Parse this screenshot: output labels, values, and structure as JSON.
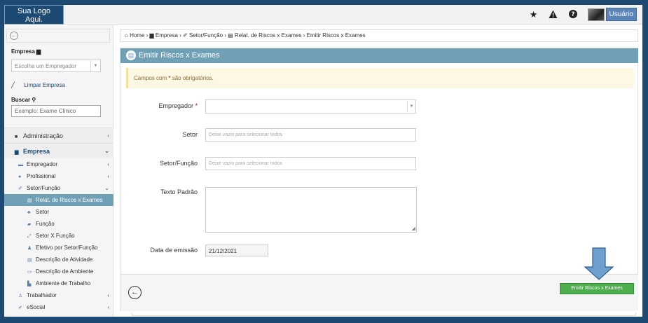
{
  "topbar": {
    "logo_line1": "Sua Logo",
    "logo_line2": "Aqui.",
    "icons": [
      "star-icon",
      "warning-icon",
      "help-icon"
    ],
    "user_label": "Usuário"
  },
  "sidebar": {
    "empresa_label": "Empresa",
    "empresa_placeholder": "Escolha um Empregador",
    "clear_label": "Limpar Empresa",
    "search_label": "Buscar",
    "search_placeholder": "Exemplo: Exame Clínico",
    "menu": [
      {
        "label": "Administração",
        "level": "top",
        "chev": "‹"
      },
      {
        "label": "Empresa",
        "level": "top-active",
        "chev": "⌄"
      },
      {
        "label": "Empregador",
        "level": "sub",
        "chev": "‹"
      },
      {
        "label": "Profissional",
        "level": "sub",
        "chev": "‹"
      },
      {
        "label": "Setor/Função",
        "level": "sub",
        "chev": "⌄"
      },
      {
        "label": "Relat. de Riscos x Exames",
        "level": "selected",
        "chev": ""
      },
      {
        "label": "Setor",
        "level": "sub2",
        "chev": ""
      },
      {
        "label": "Função",
        "level": "sub2",
        "chev": ""
      },
      {
        "label": "Setor X Função",
        "level": "sub2",
        "chev": ""
      },
      {
        "label": "Efetivo por Setor/Função",
        "level": "sub2",
        "chev": ""
      },
      {
        "label": "Descrição de Atividade",
        "level": "sub2",
        "chev": ""
      },
      {
        "label": "Descrição de Ambiente",
        "level": "sub2",
        "chev": ""
      },
      {
        "label": "Ambiente de Trabalho",
        "level": "sub2",
        "chev": ""
      },
      {
        "label": "Trabalhador",
        "level": "sub",
        "chev": "‹"
      },
      {
        "label": "eSocial",
        "level": "sub",
        "chev": "‹"
      }
    ]
  },
  "breadcrumb": {
    "home": "Home",
    "empresa": "Empresa",
    "setor_funcao": "Setor/Função",
    "relat": "Relat. de Riscos x Exames",
    "current": "Emitir Riscos x Exames"
  },
  "panel": {
    "title": "Emitir Riscos x Exames",
    "alert_prefix": "Campos com",
    "alert_star": "*",
    "alert_suffix": "são obrigatórios.",
    "fields": {
      "empregador_label": "Empregador",
      "empregador_req": "*",
      "setor_label": "Setor",
      "setor_placeholder": "Deixe vazio para selecionar todos",
      "setor_funcao_label": "Setor/Função",
      "setor_funcao_placeholder": "Deixe vazio para selecionar todos",
      "texto_padrao_label": "Texto Padrão",
      "data_emissao_label": "Data de emissão",
      "data_emissao_value": "21/12/2021"
    },
    "submit_label": "Emitir Riscos x Exames"
  },
  "colors": {
    "header_blue": "#70a0b6",
    "brand_dark": "#1d4a72",
    "submit_green": "#4cae4c",
    "arrow_blue": "#6f9fcf"
  }
}
